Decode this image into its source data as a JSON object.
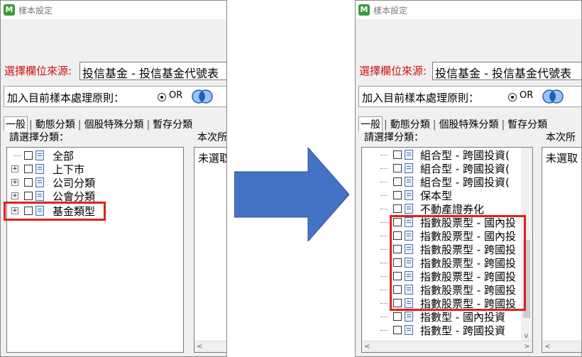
{
  "window": {
    "title": "樣本設定",
    "app_icon_letter": "M"
  },
  "source": {
    "label": "選擇欄位來源:",
    "value": "投信基金 - 投信基金代號表"
  },
  "principle": {
    "label": "加入目前樣本處理原則：",
    "option_or": "OR"
  },
  "tabs": [
    {
      "label": "一般"
    },
    {
      "label": "動態分類"
    },
    {
      "label": "個股特殊分類"
    },
    {
      "label": "暫存分類"
    }
  ],
  "pick_label": "請選擇分類：",
  "right_label": "本次所",
  "right_list_text": "未選取",
  "left_tree": [
    {
      "label": "全部",
      "expandable": false
    },
    {
      "label": "上下市",
      "expandable": true
    },
    {
      "label": "公司分類",
      "expandable": true
    },
    {
      "label": "公會分類",
      "expandable": true
    },
    {
      "label": "基金類型",
      "expandable": true
    }
  ],
  "right_tree": [
    {
      "label": "組合型 - 跨國投資("
    },
    {
      "label": "組合型 - 跨國投資("
    },
    {
      "label": "組合型 - 跨國投資("
    },
    {
      "label": "保本型"
    },
    {
      "label": "不動產證券化"
    },
    {
      "label": "指數股票型 - 國內投"
    },
    {
      "label": "指數股票型 - 國內投"
    },
    {
      "label": "指數股票型 - 跨國投"
    },
    {
      "label": "指數股票型 - 跨國投"
    },
    {
      "label": "指數股票型 - 跨國投"
    },
    {
      "label": "指數股票型 - 跨國投"
    },
    {
      "label": "指數股票型 - 跨國投"
    },
    {
      "label": "指數型 - 國內投資"
    },
    {
      "label": "指數型 - 跨國投資"
    }
  ],
  "colors": {
    "highlight": "#e0201f",
    "arrow": "#4472c4",
    "source_label": "#d01010"
  }
}
